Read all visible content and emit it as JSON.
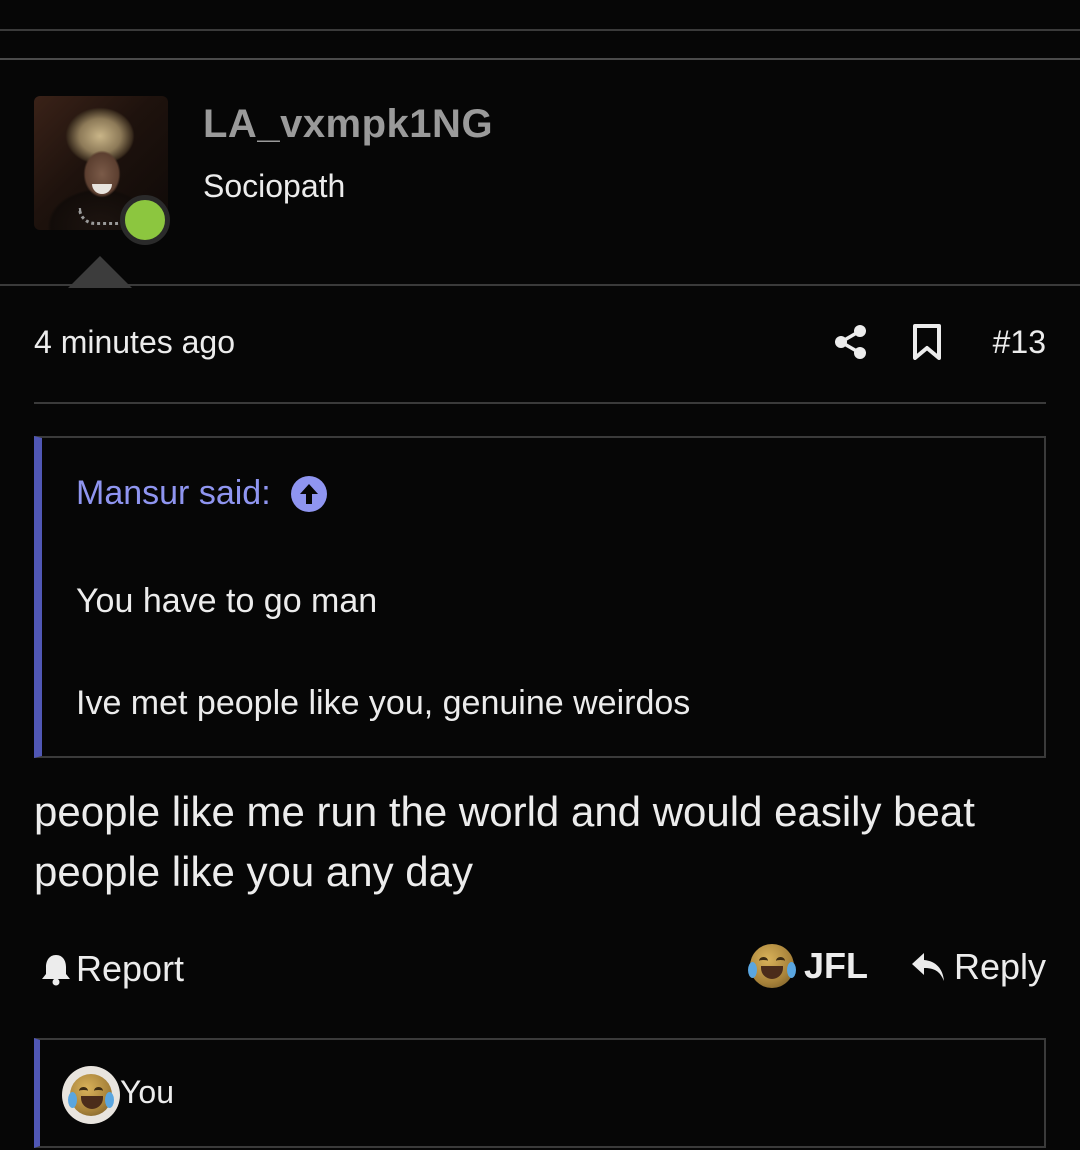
{
  "user": {
    "name": "LA_vxmpk1NG",
    "title": "Sociopath",
    "online": true
  },
  "post": {
    "timestamp": "4 minutes ago",
    "number": "#13",
    "body": "people like me run the world and would easily beat people like you any day"
  },
  "quote": {
    "author_label": "Mansur said:",
    "line1": "You have to go man",
    "line2": "Ive met people like you, genuine weirdos"
  },
  "actions": {
    "report": "Report",
    "jfl": "JFL",
    "reply": "Reply"
  },
  "reactions": {
    "who": "You"
  },
  "icons": {
    "share": "share-icon",
    "bookmark": "bookmark-icon",
    "report": "bell-icon",
    "reply": "reply-arrow-icon",
    "quote_jump": "arrow-up-circle-icon",
    "reaction": "joy-tears-emoji-icon"
  },
  "colors": {
    "background": "#060606",
    "accent": "#5057b5",
    "quote_author": "#8f95f0",
    "online": "#8cc63f",
    "username": "#9a9a9a"
  }
}
